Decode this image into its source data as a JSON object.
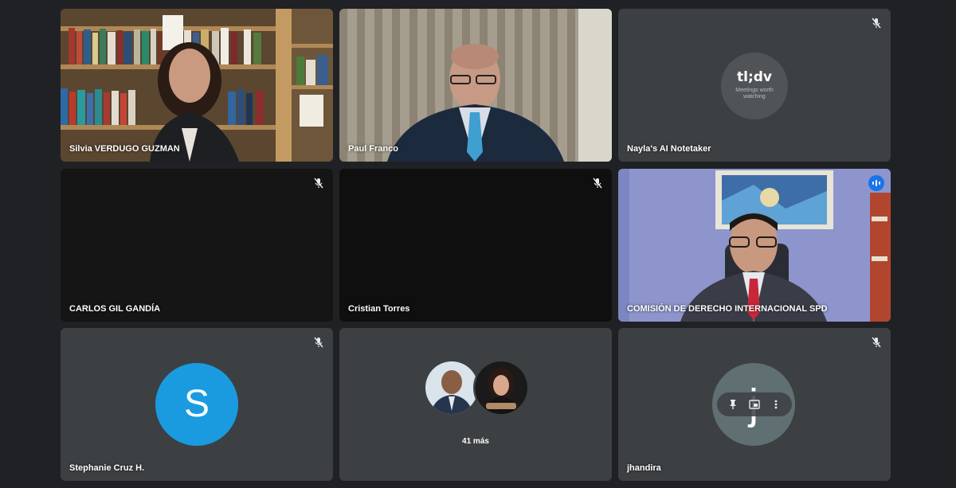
{
  "participants": [
    {
      "name": "Silvia VERDUGO GUZMAN",
      "muted": false
    },
    {
      "name": "Paul Franco",
      "muted": false
    },
    {
      "name": "Nayla's AI Notetaker",
      "muted": true,
      "logo": "tl;dv",
      "tagline": "Meetings worth watching"
    },
    {
      "name": "CARLOS GIL GANDÍA",
      "muted": true
    },
    {
      "name": "Cristian Torres",
      "muted": true
    },
    {
      "name": "COMISIÓN DE DERECHO INTERNACIONAL SPD",
      "muted": false,
      "speaking": true
    },
    {
      "name": "Stephanie Cruz H.",
      "muted": true,
      "initial": "S",
      "avatar_color": "#1a9be0"
    },
    {
      "others": "41 más"
    },
    {
      "name": "jhandira",
      "muted": true,
      "initial": "j"
    }
  ],
  "colors": {
    "background": "#202124",
    "tile": "#3c4043",
    "active_border": "#8ab4f8",
    "speaking": "#1a73e8"
  },
  "icons": {
    "mute": "mic-off-icon",
    "pin": "pin-icon",
    "pip": "picture-in-picture-icon",
    "more": "more-vert-icon",
    "speaking": "audio-level-icon"
  }
}
